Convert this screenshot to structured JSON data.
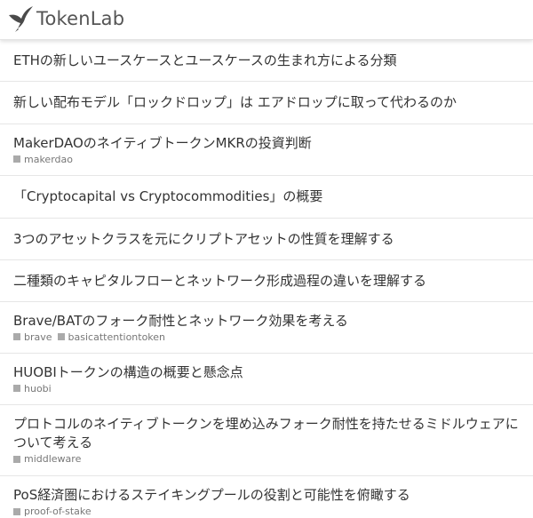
{
  "header": {
    "logo_text": "TokenLab",
    "logo_icon": "swallow-bird-icon"
  },
  "articles": [
    {
      "title": "ETHの新しいユースケースとユースケースの生まれ方による分類",
      "tags": []
    },
    {
      "title": "新しい配布モデル「ロックドロップ」は エアドロップに取って代わるのか",
      "tags": []
    },
    {
      "title": "MakerDAOのネイティブトークンMKRの投資判断",
      "tags": [
        "makerdao"
      ]
    },
    {
      "title": "「Cryptocapital vs Cryptocommodities」の概要",
      "tags": []
    },
    {
      "title": "3つのアセットクラスを元にクリプトアセットの性質を理解する",
      "tags": []
    },
    {
      "title": "二種類のキャピタルフローとネットワーク形成過程の違いを理解する",
      "tags": []
    },
    {
      "title": "Brave/BATのフォーク耐性とネットワーク効果を考える",
      "tags": [
        "brave",
        "basicattentiontoken"
      ]
    },
    {
      "title": "HUOBIトークンの構造の概要と懸念点",
      "tags": [
        "huobi"
      ]
    },
    {
      "title": "プロトコルのネイティブトークンを埋め込みフォーク耐性を持たせるミドルウェアについて考える",
      "tags": [
        "middleware"
      ]
    },
    {
      "title": "PoS経済圏におけるステイキングプールの役割と可能性を俯瞰する",
      "tags": [
        "proof-of-stake"
      ]
    }
  ]
}
